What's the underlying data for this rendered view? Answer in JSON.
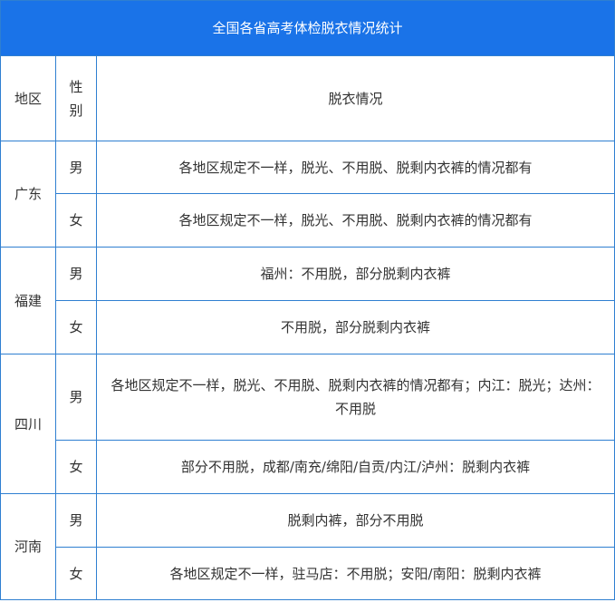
{
  "title": "全国各省高考体检脱衣情况统计",
  "headers": {
    "region": "地区",
    "gender": "性别",
    "detail": "脱衣情况"
  },
  "rows": [
    {
      "region": "广东",
      "male_label": "男",
      "male": "各地区规定不一样，脱光、不用脱、脱剩内衣裤的情况都有",
      "female_label": "女",
      "female": "各地区规定不一样，脱光、不用脱、脱剩内衣裤的情况都有"
    },
    {
      "region": "福建",
      "male_label": "男",
      "male": "福州：不用脱，部分脱剩内衣裤",
      "female_label": "女",
      "female": "不用脱，部分脱剩内衣裤"
    },
    {
      "region": "四川",
      "male_label": "男",
      "male": "各地区规定不一样，脱光、不用脱、脱剩内衣裤的情况都有；内江：脱光；达州：不用脱",
      "female_label": "女",
      "female": "部分不用脱，成都/南充/绵阳/自贡/内江/泸州：脱剩内衣裤"
    },
    {
      "region": "河南",
      "male_label": "男",
      "male": "脱剩内裤，部分不用脱",
      "female_label": "女",
      "female": "各地区规定不一样，驻马店：不用脱；安阳/南阳：脱剩内衣裤"
    }
  ]
}
